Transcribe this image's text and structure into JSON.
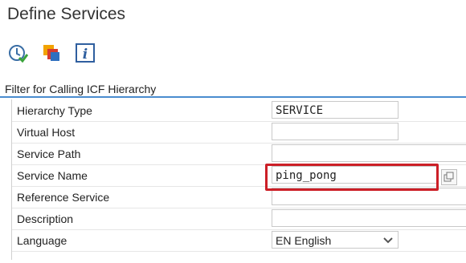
{
  "window": {
    "title": "Define Services"
  },
  "toolbar": {
    "buttons": [
      {
        "icon": "execute-clock-icon"
      },
      {
        "icon": "multi-window-icon"
      },
      {
        "icon": "info-icon"
      }
    ]
  },
  "section": {
    "title": "Filter for Calling ICF Hierarchy"
  },
  "form": {
    "hierarchy_type": {
      "label": "Hierarchy Type",
      "value": "SERVICE"
    },
    "virtual_host": {
      "label": "Virtual Host",
      "value": ""
    },
    "service_path": {
      "label": "Service Path",
      "value": ""
    },
    "service_name": {
      "label": "Service Name",
      "value": "ping_pong"
    },
    "reference_service": {
      "label": "Reference Service",
      "value": ""
    },
    "description": {
      "label": "Description",
      "value": ""
    },
    "language": {
      "label": "Language",
      "value": "EN English"
    }
  },
  "colors": {
    "accent_line": "#4a8ccf",
    "highlight": "#cc1f27"
  }
}
